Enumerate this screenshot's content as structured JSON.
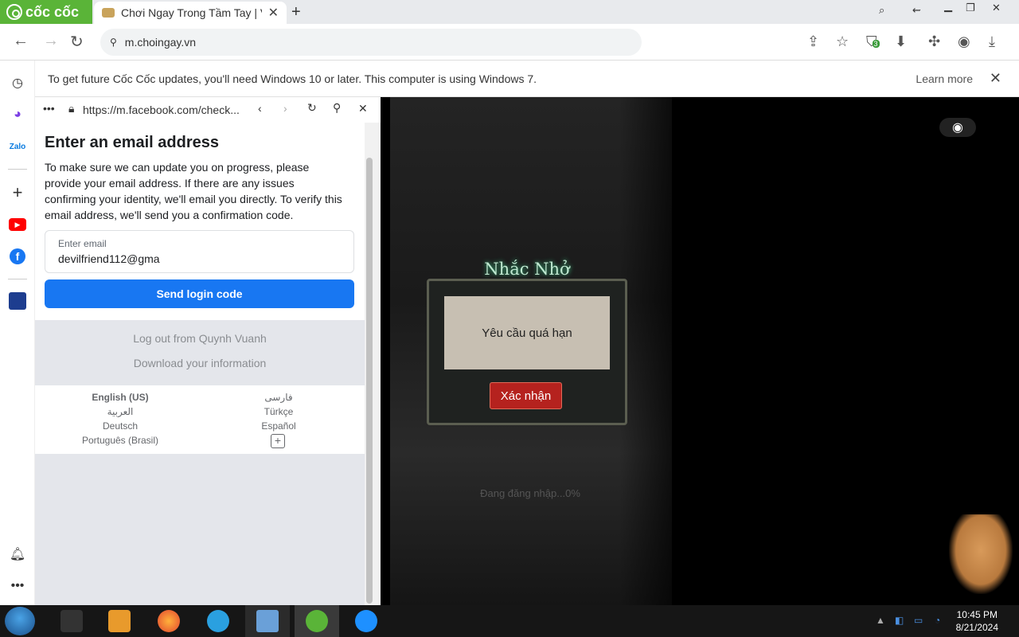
{
  "browser": {
    "brand": "cốc cốc",
    "tab_title": "Chơi Ngay Trong Tầm Tay | V",
    "url": "m.choingay.vn",
    "extension_badge": "3"
  },
  "infobar": {
    "message": "To get future Cốc Cốc updates, you'll need Windows 10 or later. This computer is using Windows 7.",
    "learn_more": "Learn more"
  },
  "sidepanel": {
    "url": "https://m.facebook.com/check...",
    "facebook": {
      "title": "Enter an email address",
      "description": "To make sure we can update you on progress, please provide your email address. If there are any issues confirming your identity, we'll email you directly. To verify this email address, we'll send you a confirmation code.",
      "email_label": "Enter email",
      "email_value": "devilfriend112@gma",
      "send_button": "Send login code",
      "logout_link": "Log out from Quynh Vuanh",
      "download_link": "Download your information",
      "languages": {
        "english": "English (US)",
        "persian": "فارسی",
        "arabic": "العربية",
        "turkish": "Türkçe",
        "german": "Deutsch",
        "spanish": "Español",
        "portuguese": "Português (Brasil)"
      }
    }
  },
  "game": {
    "dialog_title": "Nhắc Nhở",
    "dialog_message": "Yêu cầu quá hạn",
    "confirm_button": "Xác nhận",
    "loading_text": "Đang đăng nhập...0%"
  },
  "taskbar": {
    "time": "10:45 PM",
    "date": "8/21/2024"
  }
}
